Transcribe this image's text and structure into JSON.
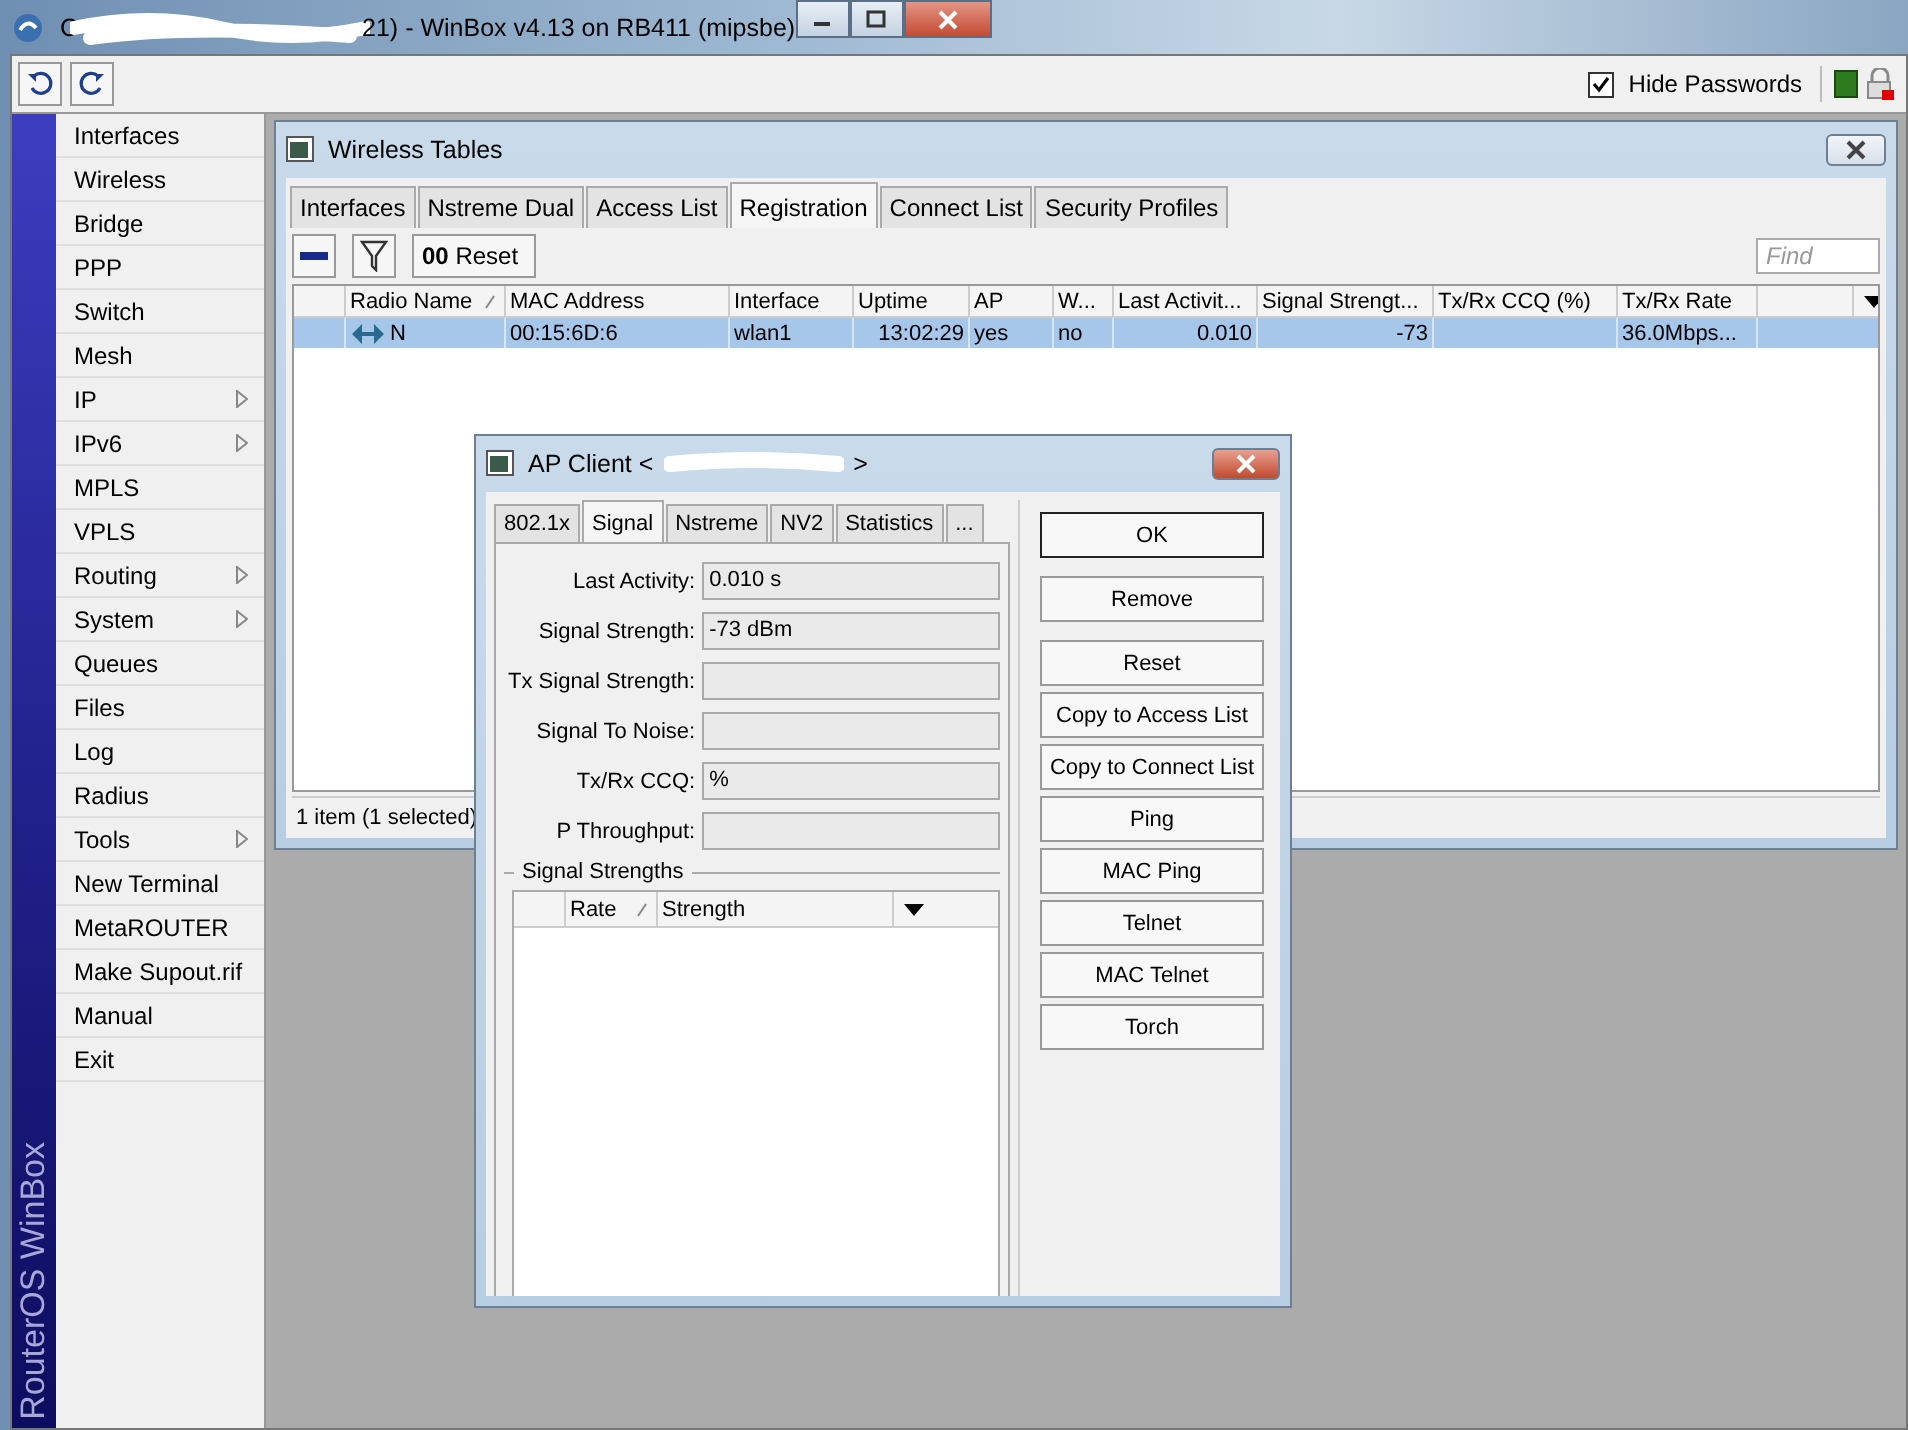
{
  "window": {
    "title_start": "C",
    "title_end": "21) - WinBox v4.13 on RB411 (mipsbe)"
  },
  "toolbar": {
    "hide_passwords": {
      "label": "Hide Passwords",
      "checked": true
    }
  },
  "sidebar": {
    "brand": "RouterOS WinBox",
    "items": [
      {
        "label": "Interfaces",
        "submenu": false
      },
      {
        "label": "Wireless",
        "submenu": false
      },
      {
        "label": "Bridge",
        "submenu": false
      },
      {
        "label": "PPP",
        "submenu": false
      },
      {
        "label": "Switch",
        "submenu": false
      },
      {
        "label": "Mesh",
        "submenu": false
      },
      {
        "label": "IP",
        "submenu": true
      },
      {
        "label": "IPv6",
        "submenu": true
      },
      {
        "label": "MPLS",
        "submenu": false
      },
      {
        "label": "VPLS",
        "submenu": false
      },
      {
        "label": "Routing",
        "submenu": true
      },
      {
        "label": "System",
        "submenu": true
      },
      {
        "label": "Queues",
        "submenu": false
      },
      {
        "label": "Files",
        "submenu": false
      },
      {
        "label": "Log",
        "submenu": false
      },
      {
        "label": "Radius",
        "submenu": false
      },
      {
        "label": "Tools",
        "submenu": true
      },
      {
        "label": "New Terminal",
        "submenu": false
      },
      {
        "label": "MetaROUTER",
        "submenu": false
      },
      {
        "label": "Make Supout.rif",
        "submenu": false
      },
      {
        "label": "Manual",
        "submenu": false
      },
      {
        "label": "Exit",
        "submenu": false
      }
    ]
  },
  "wireless_tables": {
    "title": "Wireless Tables",
    "tabs": [
      {
        "label": "Interfaces",
        "selected": false
      },
      {
        "label": "Nstreme Dual",
        "selected": false
      },
      {
        "label": "Access List",
        "selected": false
      },
      {
        "label": "Registration",
        "selected": true
      },
      {
        "label": "Connect List",
        "selected": false
      },
      {
        "label": "Security Profiles",
        "selected": false
      }
    ],
    "reset_button": {
      "icon_text": "00",
      "label": "Reset"
    },
    "find": {
      "placeholder": "Find"
    },
    "columns": [
      {
        "label": "Radio Name",
        "sorted": true
      },
      {
        "label": "MAC Address",
        "sorted": false
      },
      {
        "label": "Interface",
        "sorted": false
      },
      {
        "label": "Uptime",
        "sorted": false
      },
      {
        "label": "AP",
        "sorted": false
      },
      {
        "label": "W...",
        "sorted": false
      },
      {
        "label": "Last Activit...",
        "sorted": false
      },
      {
        "label": "Signal Strengt...",
        "sorted": false
      },
      {
        "label": "Tx/Rx CCQ (%)",
        "sorted": false
      },
      {
        "label": "Tx/Rx Rate",
        "sorted": false
      }
    ],
    "rows": [
      {
        "selected": true,
        "cells": [
          "N",
          "00:15:6D:6",
          "wlan1",
          "13:02:29",
          "yes",
          "no",
          "0.010",
          "-73",
          "",
          "36.0Mbps..."
        ]
      }
    ],
    "status": "1 item (1 selected)"
  },
  "ap_client": {
    "title_start": "AP Client <",
    "title_end": ">",
    "tabs": [
      {
        "label": "802.1x",
        "selected": false
      },
      {
        "label": "Signal",
        "selected": true
      },
      {
        "label": "Nstreme",
        "selected": false
      },
      {
        "label": "NV2",
        "selected": false
      },
      {
        "label": "Statistics",
        "selected": false
      },
      {
        "label": "...",
        "selected": false
      }
    ],
    "fields": [
      {
        "label": "Last Activity:",
        "value": "0.010 s"
      },
      {
        "label": "Signal Strength:",
        "value": "-73 dBm"
      },
      {
        "label": "Tx Signal Strength:"
      },
      {
        "label": "Signal To Noise:"
      },
      {
        "label": "Tx/Rx CCQ:",
        "value": "%"
      },
      {
        "label": "P Throughput:"
      }
    ],
    "group": "Signal Strengths",
    "columns": [
      {
        "label": "Rate",
        "sorted": true
      },
      {
        "label": "Strength",
        "sorted": false
      }
    ],
    "buttons": [
      {
        "label": "OK",
        "default": true
      },
      {
        "label": "Remove",
        "default": false
      },
      {
        "label": "Reset",
        "default": false
      },
      {
        "label": "Copy to Access List",
        "default": false
      },
      {
        "label": "Copy to Connect List",
        "default": false
      },
      {
        "label": "Ping",
        "default": false
      },
      {
        "label": "MAC Ping",
        "default": false
      },
      {
        "label": "Telnet",
        "default": false
      },
      {
        "label": "MAC Telnet",
        "default": false
      },
      {
        "label": "Torch",
        "default": false
      }
    ]
  }
}
